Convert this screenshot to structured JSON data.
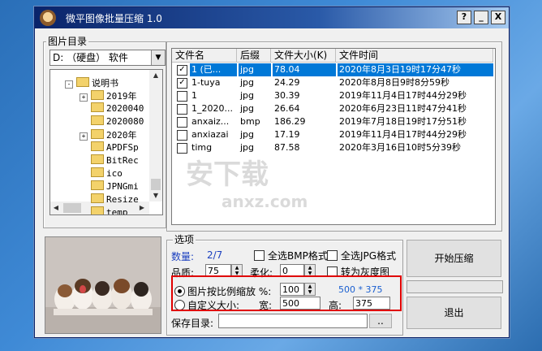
{
  "window": {
    "title": "微平图像批量压缩 1.0",
    "help": "?",
    "minimize": "_",
    "close": "X"
  },
  "dir_panel": {
    "label": "图片目录",
    "drive": "D: （硬盘） 软件",
    "tree": [
      {
        "label": "说明书",
        "expander": "-",
        "level": 0
      },
      {
        "label": "2019年",
        "expander": "+",
        "level": 1
      },
      {
        "label": "2020040",
        "expander": "",
        "level": 1
      },
      {
        "label": "2020080",
        "expander": "",
        "level": 1
      },
      {
        "label": "2020年",
        "expander": "+",
        "level": 1
      },
      {
        "label": "APDFSp",
        "expander": "",
        "level": 1
      },
      {
        "label": "BitRec",
        "expander": "",
        "level": 1
      },
      {
        "label": "ico",
        "expander": "",
        "level": 1
      },
      {
        "label": "JPNGmi",
        "expander": "",
        "level": 1
      },
      {
        "label": "Resize",
        "expander": "",
        "level": 1
      },
      {
        "label": "temp",
        "expander": "",
        "level": 1
      }
    ]
  },
  "file_list": {
    "headers": [
      "文件名",
      "后缀",
      "文件大小(K)",
      "文件时间"
    ],
    "rows": [
      {
        "checked": true,
        "name": "1 (已...",
        "ext": "jpg",
        "size": "78.04",
        "time": "2020年8月3日19时17分47秒",
        "selected": true
      },
      {
        "checked": true,
        "name": "1-tuya",
        "ext": "jpg",
        "size": "24.29",
        "time": "2020年8月8日9时8分59秒",
        "selected": false
      },
      {
        "checked": false,
        "name": "1",
        "ext": "jpg",
        "size": "30.39",
        "time": "2019年11月4日17时44分29秒",
        "selected": false
      },
      {
        "checked": false,
        "name": "1_2020...",
        "ext": "jpg",
        "size": "26.64",
        "time": "2020年6月23日11时47分41秒",
        "selected": false
      },
      {
        "checked": false,
        "name": "anxaiz...",
        "ext": "bmp",
        "size": "186.29",
        "time": "2019年7月18日19时17分51秒",
        "selected": false
      },
      {
        "checked": false,
        "name": "anxiazai",
        "ext": "jpg",
        "size": "17.19",
        "time": "2019年11月4日17时44分29秒",
        "selected": false
      },
      {
        "checked": false,
        "name": "timg",
        "ext": "jpg",
        "size": "87.58",
        "time": "2020年3月16日10时5分39秒",
        "selected": false
      }
    ]
  },
  "options": {
    "label": "选项",
    "count_label": "数量:",
    "count_value": "2/7",
    "select_all_bmp": "全选BMP格式",
    "select_all_jpg": "全选JPG格式",
    "quality_label": "品质:",
    "quality_value": "75",
    "soften_label": "柔化:",
    "soften_value": "0",
    "grayscale_label": "转为灰度图",
    "scale_radio": "图片按比例缩放 %:",
    "scale_value": "100",
    "dimensions": "500 * 375",
    "custom_radio": "自定义大小:",
    "width_label": "宽:",
    "width_value": "500",
    "height_label": "高:",
    "height_value": "375",
    "save_dir_label": "保存目录:",
    "save_dir_value": "",
    "browse": "..",
    "start_button": "开始压缩",
    "exit_button": "退出",
    "progress": 0
  },
  "watermark": {
    "big": "安下载",
    "small": "anxz.com"
  }
}
